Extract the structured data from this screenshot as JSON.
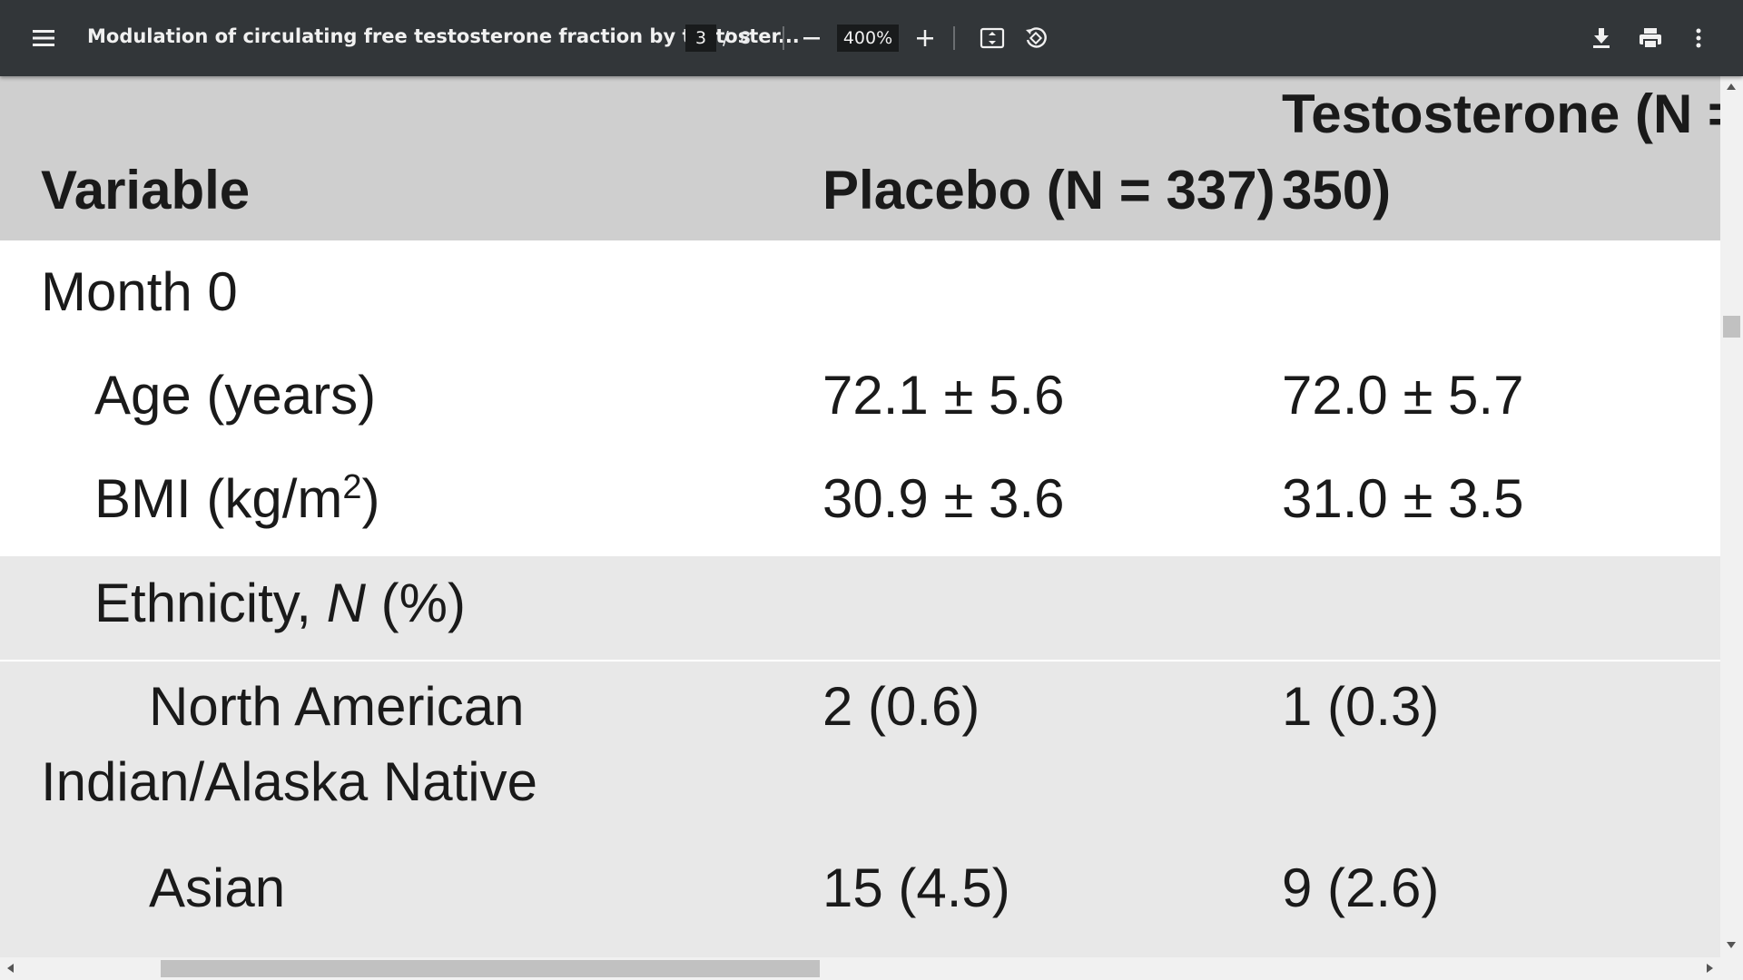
{
  "toolbar": {
    "title": "Modulation of circulating free testosterone fraction by testoster...",
    "page_current": "3",
    "page_separator": "/",
    "page_total": "8",
    "zoom": "400%"
  },
  "table": {
    "header": {
      "variable": "Variable",
      "placebo": "Placebo (N = 337)",
      "testosterone_line1": "Testosterone (N =",
      "testosterone_line2": "350)"
    },
    "rows": [
      {
        "label": "Month 0",
        "placebo": "",
        "testosterone": ""
      },
      {
        "label": "Age (years)",
        "placebo": "72.1 ± 5.6",
        "testosterone": "72.0 ± 5.7"
      },
      {
        "label_prefix": "BMI (kg/m",
        "label_sup": "2",
        "label_suffix": ")",
        "placebo": "30.9 ± 3.6",
        "testosterone": "31.0 ± 3.5"
      },
      {
        "label_prefix": "Ethnicity, ",
        "label_italic": "N",
        "label_suffix": " (%)",
        "placebo": "",
        "testosterone": ""
      },
      {
        "label_line1": "North American",
        "label_line2": "Indian/Alaska Native",
        "placebo": "2 (0.6)",
        "testosterone": "1 (0.3)"
      },
      {
        "label": "Asian",
        "placebo": "15 (4.5)",
        "testosterone": "9 (2.6)"
      }
    ]
  },
  "colors": {
    "toolbar_bg": "#323639",
    "header_bg": "#cfcfcf",
    "grey_row_bg": "#e8e8e8",
    "page_bg": "#ffffff"
  }
}
